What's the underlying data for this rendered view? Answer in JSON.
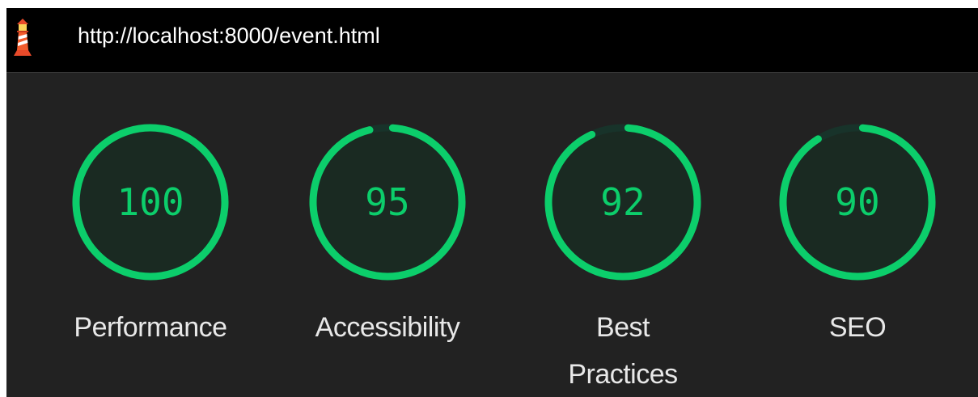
{
  "url_bar": {
    "url": "http://localhost:8000/event.html",
    "icon": "lighthouse-icon"
  },
  "colors": {
    "pass": "#0cce6b",
    "gauge_fill": "#1a2a22",
    "track": "#18332a",
    "background": "#222222",
    "url_bar_background": "#000000"
  },
  "gauges": [
    {
      "score": 100,
      "title": "Performance"
    },
    {
      "score": 95,
      "title": "Accessibility"
    },
    {
      "score": 92,
      "title": "Best Practices"
    },
    {
      "score": 90,
      "title": "SEO"
    }
  ]
}
